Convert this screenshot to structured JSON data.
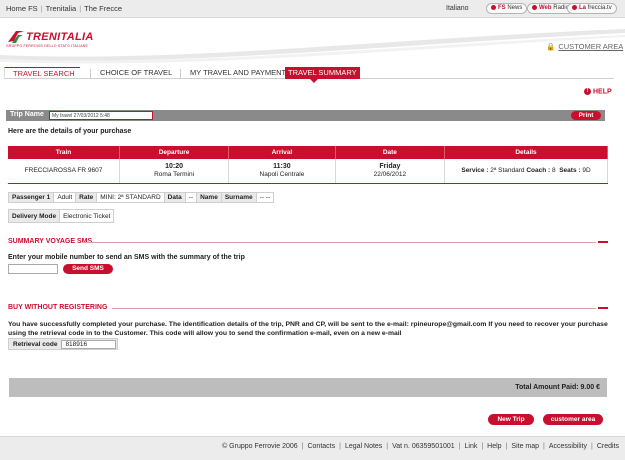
{
  "topbar": {
    "links": [
      "Home FS",
      "Trenitalia",
      "The Frecce"
    ],
    "language": "Italiano",
    "badges": [
      {
        "brand": "FS",
        "label": "News"
      },
      {
        "brand": "Web",
        "label": "Radio"
      },
      {
        "brand": "La",
        "label": "freccia.tv"
      }
    ]
  },
  "header": {
    "logo_text": "TRENITALIA",
    "logo_subtitle": "GRUPPO FERROVIE DELLO STATO ITALIANE",
    "customer_area": "CUSTOMER AREA"
  },
  "tabs": [
    "TRAVEL SEARCH",
    "CHOICE OF TRAVEL",
    "MY TRAVEL AND PAYMENT",
    "TRAVEL SUMMARY"
  ],
  "help_label": "HELP",
  "trip": {
    "label": "Trip Name",
    "value": "My travel 27/03/2012 5:48",
    "print_label": "Print"
  },
  "details_heading": "Here are the details of your purchase",
  "journey": {
    "columns": [
      "Train",
      "Departure",
      "Arrival",
      "Date",
      "Details"
    ],
    "train": "FRECCIAROSSA FR 9607",
    "departure_time": "10:20",
    "departure_station": "Roma Termini",
    "arrival_time": "11:30",
    "arrival_station": "Napoli Centrale",
    "date_day": "Friday",
    "date": "22/06/2012",
    "service_label": "Service :",
    "service_value": "2ª Standard",
    "coach_label": "Coach :",
    "coach_value": "8",
    "seats_label": "Seats :",
    "seats_value": "9D"
  },
  "passenger": {
    "title": "Passenger 1",
    "type": "Adult",
    "rate_label": "Rate",
    "rate_value": "MINI: 2ª STANDARD",
    "data_label": "Data",
    "data_value": "--",
    "name_label": "Name",
    "surname_label": "Surname",
    "surname_value": "-- --"
  },
  "delivery": {
    "label": "Delivery Mode",
    "value": "Electronic Ticket"
  },
  "sms": {
    "title": "SUMMARY VOYAGE SMS",
    "instruction": "Enter your mobile number to send an SMS with the summary of the trip",
    "input_value": "",
    "button": "Send SMS"
  },
  "buy": {
    "title": "BUY WITHOUT REGISTERING",
    "text": "You have successfully completed your purchase. The identification details of the trip, PNR and CP, will be sent to the e-mail: rpineurope@gmail.com If you need to recover your purchase using the retrieval code in to the Customer. This code will allow you to send the confirmation e-mail, even on a new e-mail",
    "code_label": "Retrieval code",
    "code_value": "818916"
  },
  "total": "Total Amount Paid: 9.00 €",
  "buttons": {
    "new_trip": "New Trip",
    "customer_area": "customer area"
  },
  "footer": [
    "© Gruppo Ferrovie 2006",
    "Contacts",
    "Legal Notes",
    "Vat n. 06359501001",
    "Link",
    "Help",
    "Site map",
    "Accessibility",
    "Credits"
  ],
  "colors": {
    "brand_red": "#c8102e",
    "bar_gray": "#8a8a8a",
    "total_gray": "#bdbdbd"
  }
}
